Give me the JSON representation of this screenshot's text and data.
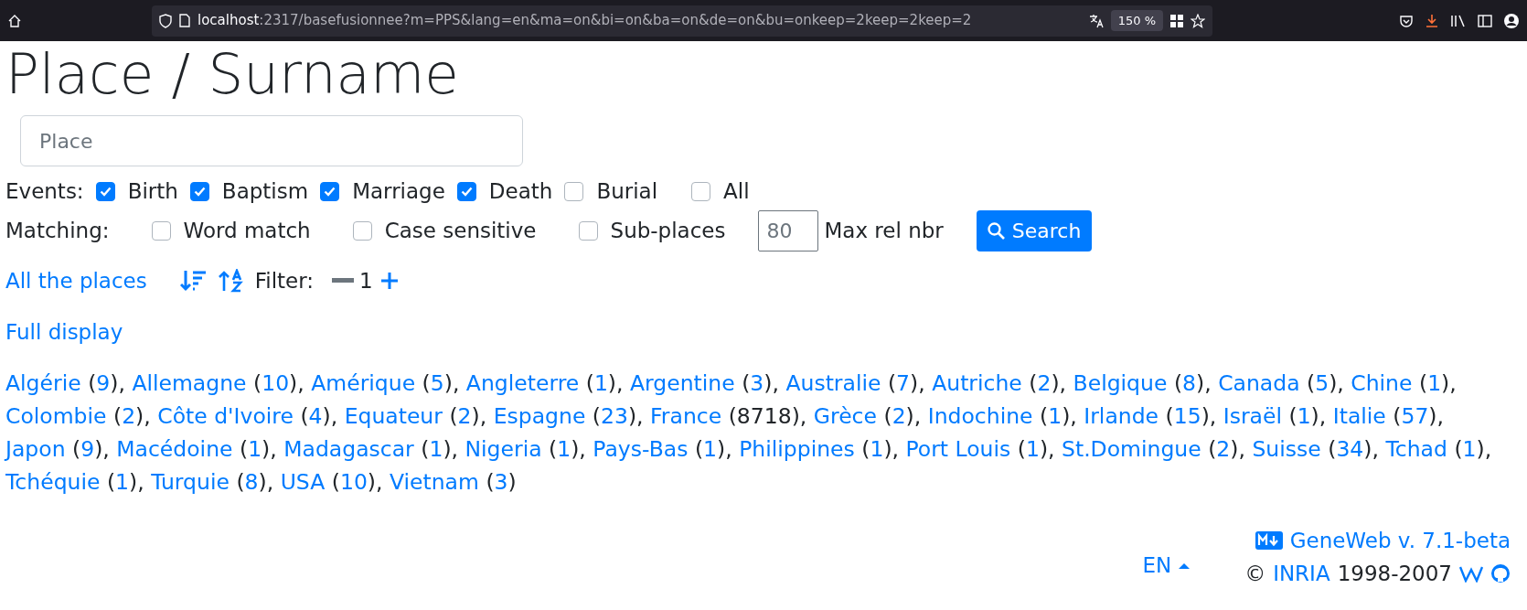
{
  "browser": {
    "host": "localhost",
    "path": ":2317/basefusionnee?m=PPS&lang=en&ma=on&bi=on&ba=on&de=on&bu=onkeep=2keep=2keep=2",
    "zoom": "150 %"
  },
  "title": "Place / Surname",
  "search": {
    "placeholder": "Place"
  },
  "events": {
    "label": "Events:",
    "options": [
      {
        "label": "Birth",
        "checked": true
      },
      {
        "label": "Baptism",
        "checked": true
      },
      {
        "label": "Marriage",
        "checked": true
      },
      {
        "label": "Death",
        "checked": true
      },
      {
        "label": "Burial",
        "checked": false
      },
      {
        "label": "All",
        "checked": false
      }
    ]
  },
  "matching": {
    "label": "Matching:",
    "options": [
      {
        "label": "Word match",
        "checked": false
      },
      {
        "label": "Case sensitive",
        "checked": false
      },
      {
        "label": "Sub-places",
        "checked": false
      }
    ],
    "max_rel": {
      "value": "80",
      "label": "Max rel nbr"
    },
    "button": "Search"
  },
  "toolbar": {
    "all_places": "All the places",
    "filter_label": "Filter:",
    "filter_value": "1"
  },
  "full_display": "Full display",
  "punctuation": {
    "open": "(",
    "close": ")",
    "separator": ","
  },
  "places": [
    {
      "name": "Algérie",
      "count": "9",
      "count_link": true
    },
    {
      "name": "Allemagne",
      "count": "10",
      "count_link": true
    },
    {
      "name": "Amérique",
      "count": "5",
      "count_link": true
    },
    {
      "name": "Angleterre",
      "count": "1",
      "count_link": true
    },
    {
      "name": "Argentine",
      "count": "3",
      "count_link": true
    },
    {
      "name": "Australie",
      "count": "7",
      "count_link": true
    },
    {
      "name": "Autriche",
      "count": "2",
      "count_link": true
    },
    {
      "name": "Belgique",
      "count": "8",
      "count_link": true
    },
    {
      "name": "Canada",
      "count": "5",
      "count_link": true
    },
    {
      "name": "Chine",
      "count": "1",
      "count_link": true
    },
    {
      "name": "Colombie",
      "count": "2",
      "count_link": true
    },
    {
      "name": "Côte d'Ivoire",
      "count": "4",
      "count_link": true
    },
    {
      "name": "Equateur",
      "count": "2",
      "count_link": true
    },
    {
      "name": "Espagne",
      "count": "23",
      "count_link": true
    },
    {
      "name": "France",
      "count": "8718",
      "count_link": false
    },
    {
      "name": "Grèce",
      "count": "2",
      "count_link": true
    },
    {
      "name": "Indochine",
      "count": "1",
      "count_link": true
    },
    {
      "name": "Irlande",
      "count": "15",
      "count_link": true
    },
    {
      "name": "Israël",
      "count": "1",
      "count_link": true
    },
    {
      "name": "Italie",
      "count": "57",
      "count_link": true
    },
    {
      "name": "Japon",
      "count": "9",
      "count_link": true
    },
    {
      "name": "Macédoine",
      "count": "1",
      "count_link": true
    },
    {
      "name": "Madagascar",
      "count": "1",
      "count_link": true
    },
    {
      "name": "Nigeria",
      "count": "1",
      "count_link": true
    },
    {
      "name": "Pays-Bas",
      "count": "1",
      "count_link": true
    },
    {
      "name": "Philippines",
      "count": "1",
      "count_link": true
    },
    {
      "name": "Port Louis",
      "count": "1",
      "count_link": true
    },
    {
      "name": "St.Domingue",
      "count": "2",
      "count_link": true
    },
    {
      "name": "Suisse",
      "count": "34",
      "count_link": true
    },
    {
      "name": "Tchad",
      "count": "1",
      "count_link": true
    },
    {
      "name": "Tchéquie",
      "count": "1",
      "count_link": true
    },
    {
      "name": "Turquie",
      "count": "8",
      "count_link": true
    },
    {
      "name": "USA",
      "count": "10",
      "count_link": true
    },
    {
      "name": "Vietnam",
      "count": "3",
      "count_link": true
    }
  ],
  "footer": {
    "language": "EN",
    "version": "GeneWeb v. 7.1-beta",
    "copyright": "©",
    "org": "INRIA",
    "years": "1998-2007"
  }
}
